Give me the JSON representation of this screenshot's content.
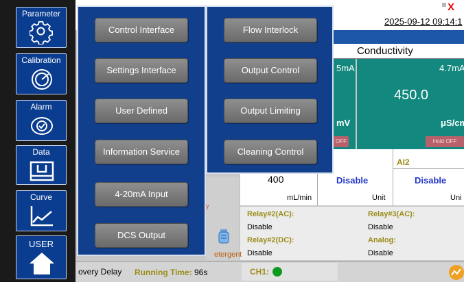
{
  "window": {
    "close_label": "X",
    "datetime": "2025-09-12 09:14:1"
  },
  "sidebar": {
    "items": [
      {
        "label": "Parameter",
        "icon": "gear-icon"
      },
      {
        "label": "Calibration",
        "icon": "gauge-icon"
      },
      {
        "label": "Alarm",
        "icon": "alarm-icon"
      },
      {
        "label": "Data",
        "icon": "download-icon"
      },
      {
        "label": "Curve",
        "icon": "chart-line-icon"
      },
      {
        "label": "USER",
        "icon": "home-icon"
      }
    ]
  },
  "parameter_menu": {
    "left": [
      "Control Interface",
      "Settings Interface",
      "User Defined",
      "Information Service",
      "4-20mA Input",
      "DCS Output"
    ],
    "right": [
      "Flow Interlock",
      "Output Control",
      "Output Limiting",
      "Cleaning Control"
    ]
  },
  "conductivity": {
    "title": "Conductivity",
    "ma_left": "5mA",
    "ma_right": "4.7mA",
    "value": "450.0",
    "mv_label": "mV",
    "unit": "μS/cm",
    "off_label": "OFF",
    "hold_label": "Hold OFF"
  },
  "inputs": {
    "ai2_label": "AI2",
    "flow_value": "400",
    "flow_unit": "mL/min",
    "status_1": "Disable",
    "status_2": "Disable",
    "unit_1": "Unit",
    "unit_2": "Uni"
  },
  "relays": {
    "relay2_ac_label": "Relay#2(AC):",
    "relay2_ac_value": "Disable",
    "relay3_ac_label": "Relay#3(AC):",
    "relay3_ac_value": "Disable",
    "relay2_dc_label": "Relay#2(DC):",
    "relay2_dc_value": "Disable",
    "analog_label": "Analog:",
    "analog_value": "Disable"
  },
  "cleaning": {
    "y_mark": "y",
    "detergent_label": "etergent"
  },
  "status_bar": {
    "recovery_label": "overy Delay",
    "running_label": "Running Time:",
    "running_value": "96s",
    "ch1_label": "CH1:",
    "ch1_status_color": "#0e9a20"
  },
  "colors": {
    "menu_bg": "#123f8b",
    "sidebar_button": "#0a3c8f",
    "teal_panel": "#13887f",
    "status_label": "#9b8c1a"
  }
}
